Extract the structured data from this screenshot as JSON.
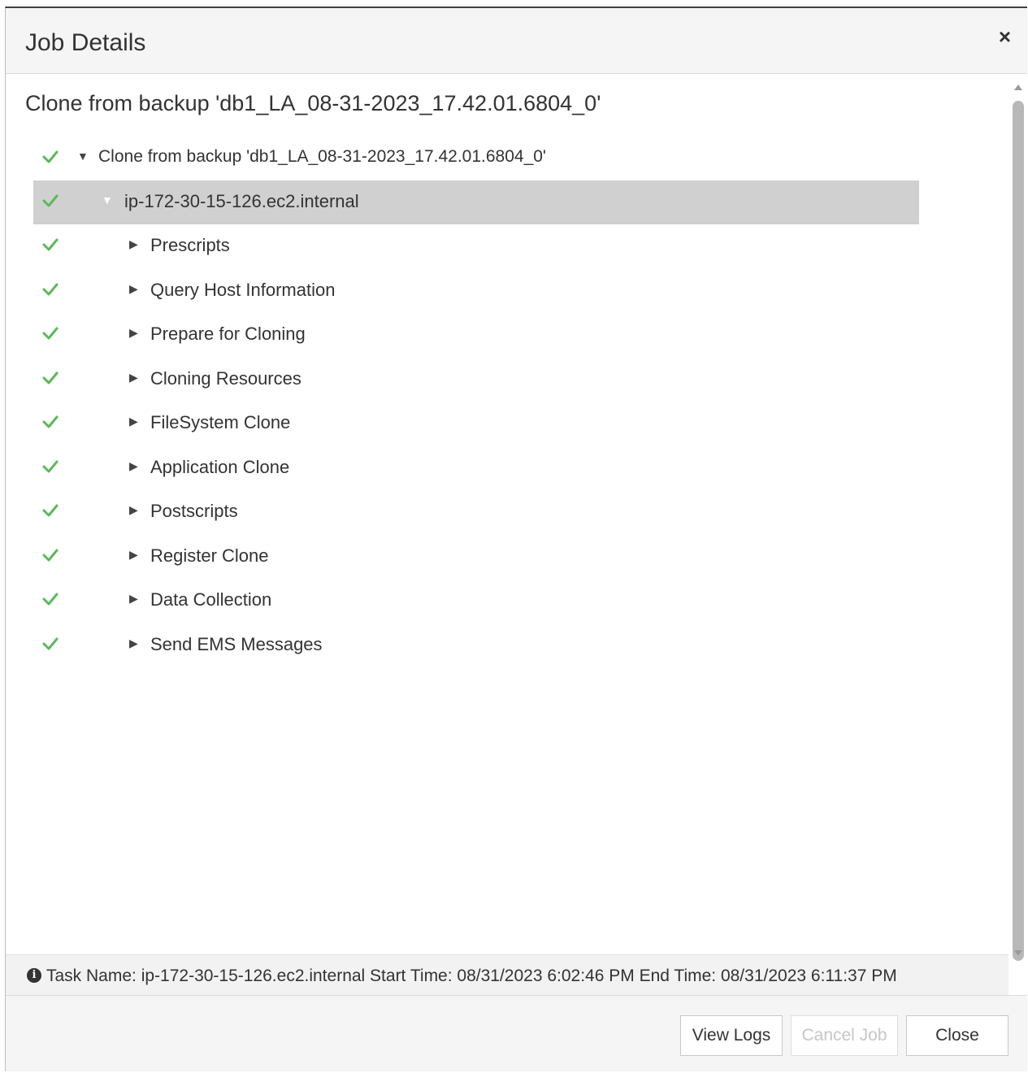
{
  "dialog": {
    "title": "Job Details",
    "close_glyph": "×"
  },
  "job": {
    "heading": "Clone from backup 'db1_LA_08-31-2023_17.42.01.6804_0'",
    "root_label": "Clone from backup 'db1_LA_08-31-2023_17.42.01.6804_0'",
    "host_label": "ip-172-30-15-126.ec2.internal",
    "steps": [
      "Prescripts",
      "Query Host Information",
      "Prepare for Cloning",
      "Cloning Resources",
      "FileSystem Clone",
      "Application Clone",
      "Postscripts",
      "Register Clone",
      "Data Collection",
      "Send EMS Messages"
    ],
    "step_status": "success"
  },
  "status_bar": {
    "text": "Task Name: ip-172-30-15-126.ec2.internal Start Time: 08/31/2023 6:02:46 PM End Time: 08/31/2023 6:11:37 PM"
  },
  "buttons": {
    "view_logs": "View Logs",
    "cancel_job": "Cancel Job",
    "close": "Close"
  },
  "colors": {
    "check_green": "#5cb85c",
    "selected_row": "#d0d0d0"
  },
  "icons": {
    "check": "check-icon",
    "expand": "caret-down-icon",
    "collapse": "caret-right-icon",
    "info": "info-circle-icon"
  }
}
